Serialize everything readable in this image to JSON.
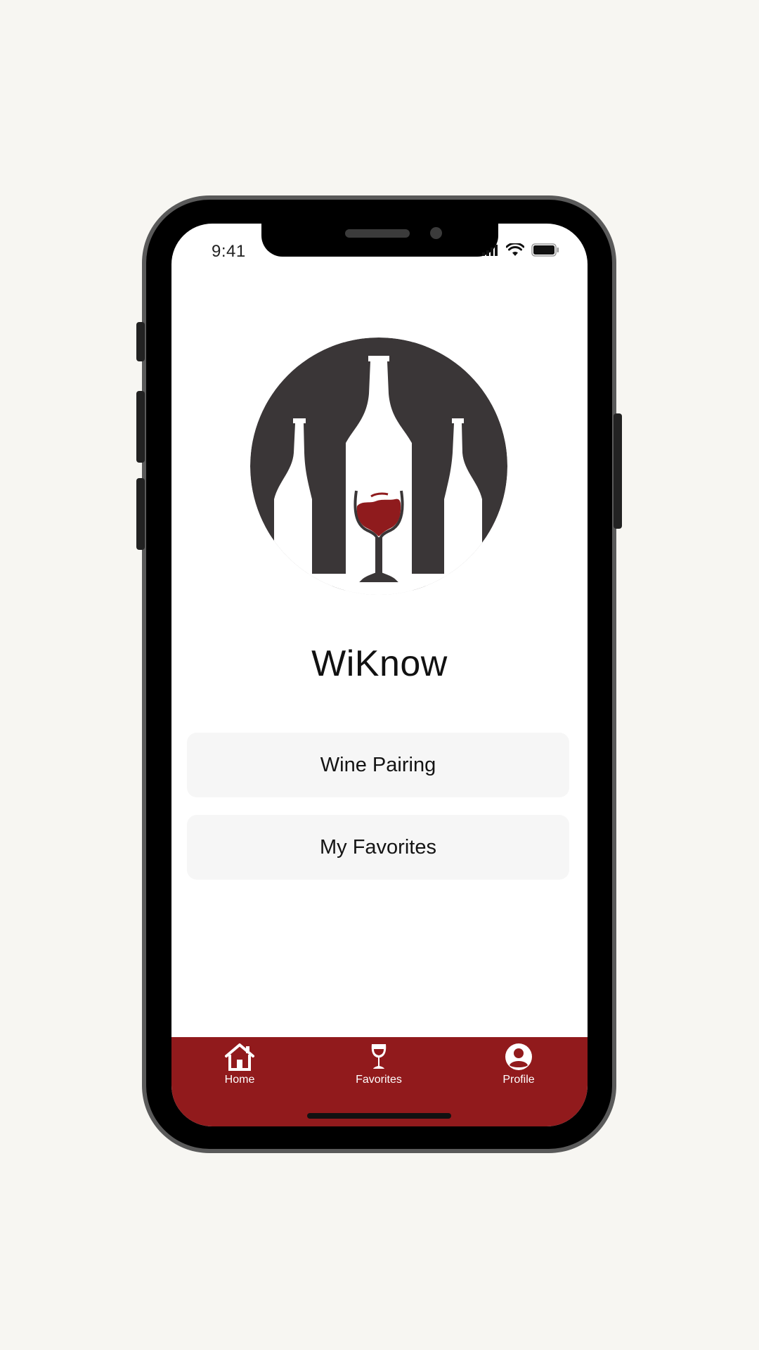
{
  "status_bar": {
    "time": "9:41",
    "icons": [
      "signal-icon",
      "wifi-icon",
      "battery-icon"
    ]
  },
  "app": {
    "title": "WiKnow",
    "logo_icon": "wine-bottles-logo",
    "colors": {
      "brand": "#911a1c",
      "logo_dark": "#3a3637",
      "wine": "#8f1b1d"
    }
  },
  "menu": {
    "wine_pairing_label": "Wine Pairing",
    "my_favorites_label": "My Favorites"
  },
  "tab_bar": {
    "tabs": [
      {
        "label": "Home",
        "icon": "home-icon"
      },
      {
        "label": "Favorites",
        "icon": "wine-glass-icon"
      },
      {
        "label": "Profile",
        "icon": "profile-icon"
      }
    ]
  }
}
